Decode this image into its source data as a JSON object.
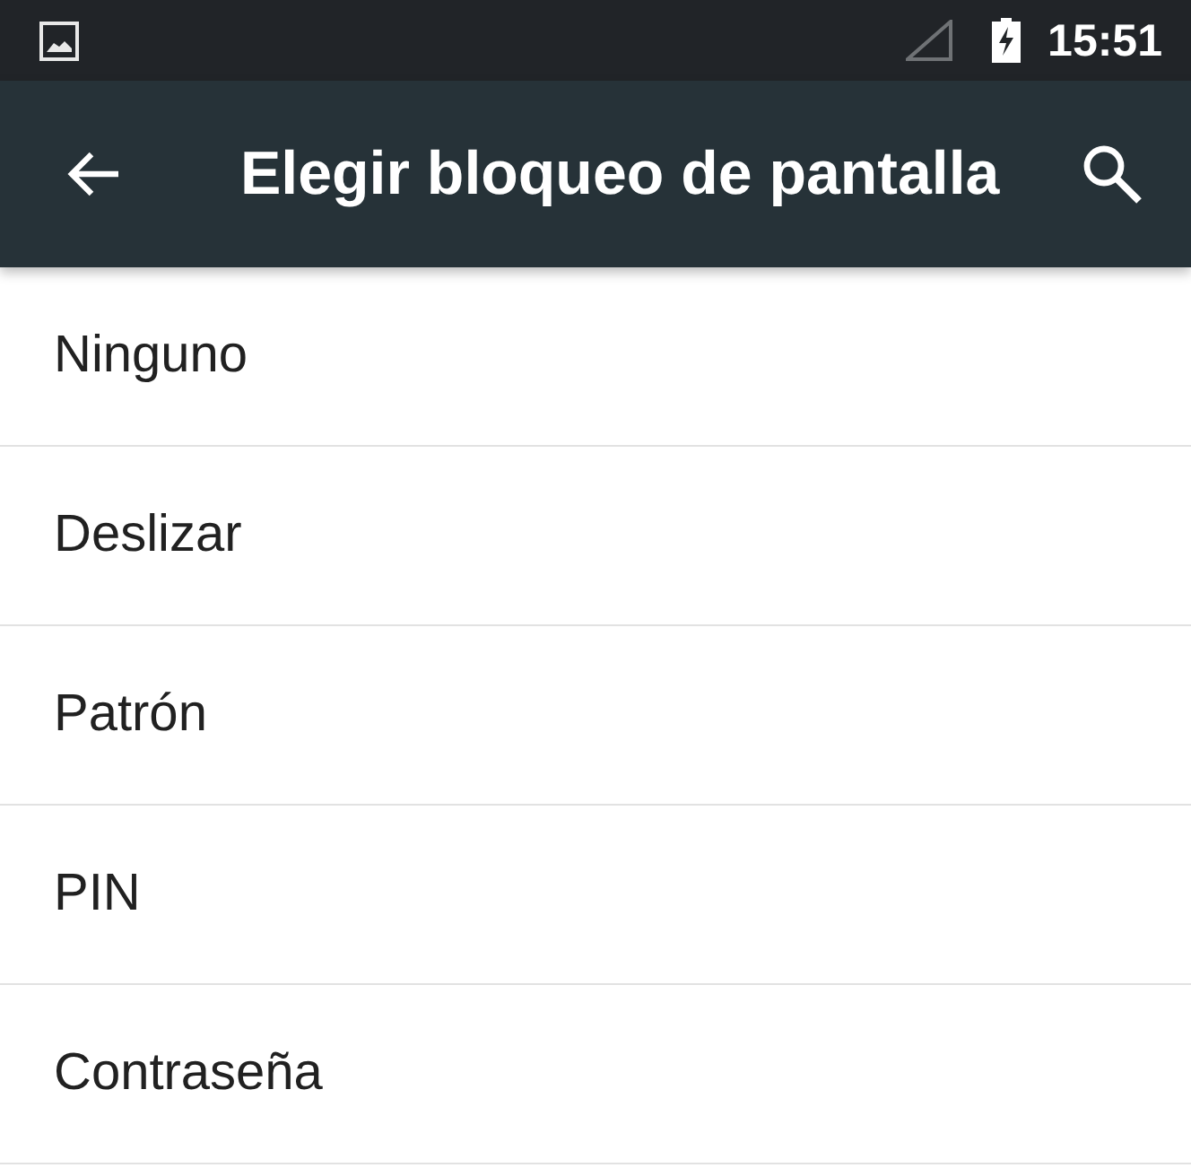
{
  "status_bar": {
    "time": "15:51"
  },
  "toolbar": {
    "title": "Elegir bloqueo de pantalla"
  },
  "options": [
    {
      "label": "Ninguno"
    },
    {
      "label": "Deslizar"
    },
    {
      "label": "Patrón"
    },
    {
      "label": "PIN"
    },
    {
      "label": "Contraseña"
    }
  ]
}
